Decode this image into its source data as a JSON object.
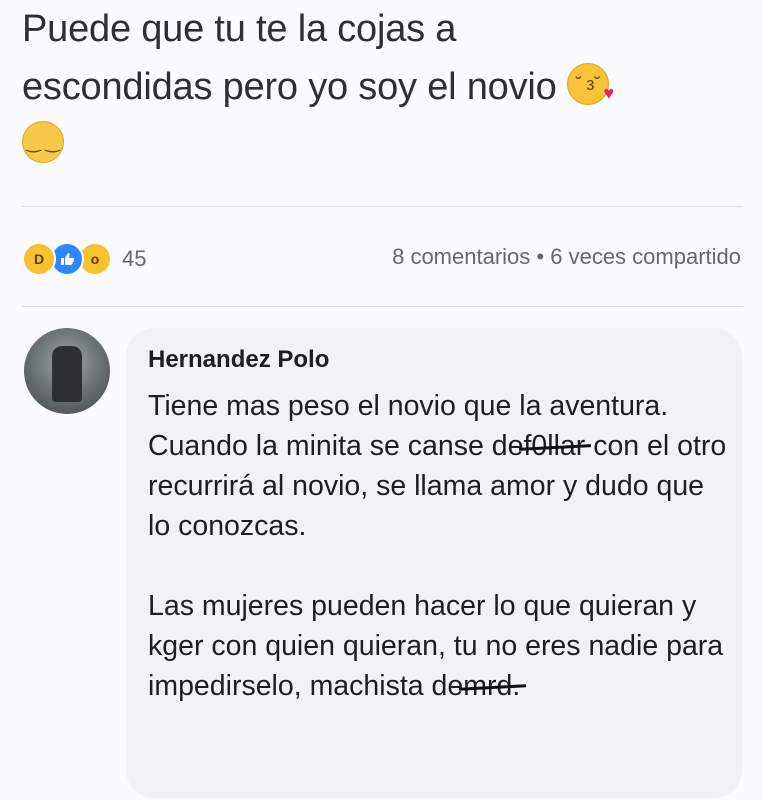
{
  "post": {
    "text_line1": "Puede que tu te la cojas a",
    "text_line2": "escondidas pero yo soy el novio",
    "emoji1": "face-blowing-kiss-icon",
    "emoji2": "relieved-face-icon"
  },
  "reactions": {
    "icons": [
      "haha-reaction-icon",
      "like-reaction-icon",
      "wow-reaction-icon"
    ],
    "count": "45",
    "comments": "8 comentarios",
    "separator": "•",
    "shares": "6 veces compartido"
  },
  "comment": {
    "author": "Hernandez Polo",
    "p1_a": "Tiene mas peso el novio que la aventura. Cuando la minita se canse de",
    "p1_censored": "f0llar",
    "p1_b": "con el otro recurrirá al novio, se llama amor y dudo que lo conozcas.",
    "p2_a": "Las mujeres pueden hacer lo que quieran y kger con quien quieran, tu no eres nadie para impedirselo, machista de",
    "p2_censored": "mrd."
  },
  "colors": {
    "like_blue": "#2d88ff",
    "emoji_yellow": "#f6c12f",
    "bubble_bg": "#f0f2f5",
    "meta_text": "#65676b"
  }
}
